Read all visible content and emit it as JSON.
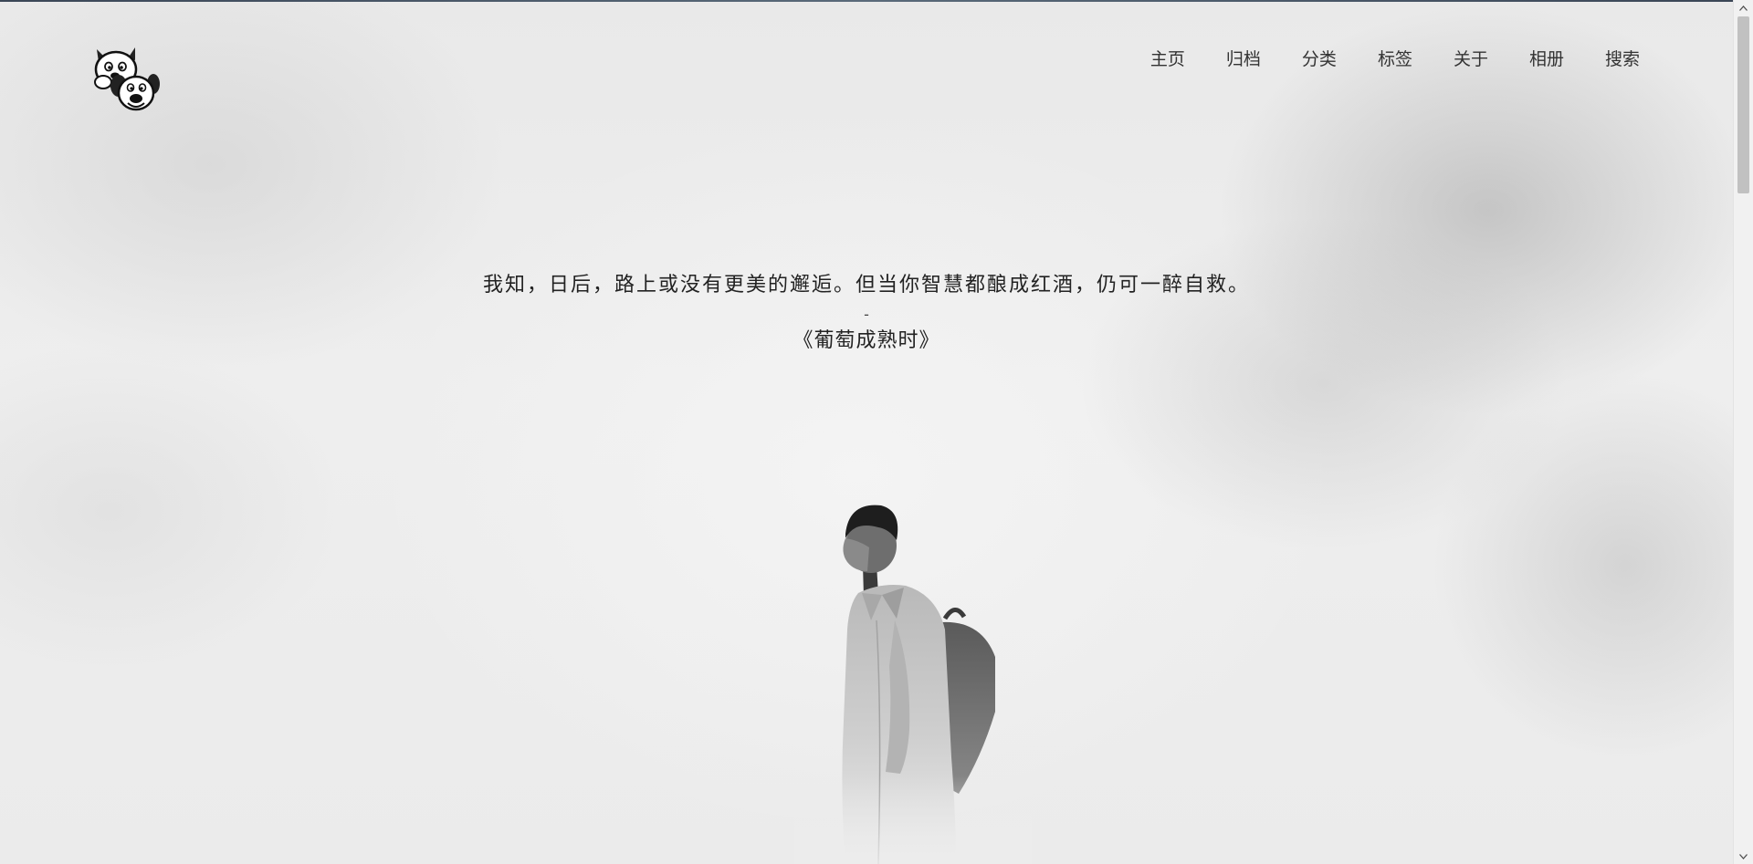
{
  "site": {
    "logo_icon": "cartoon-dogs-logo-icon"
  },
  "nav": {
    "items": [
      {
        "label": "主页"
      },
      {
        "label": "归档"
      },
      {
        "label": "分类"
      },
      {
        "label": "标签"
      },
      {
        "label": "关于"
      },
      {
        "label": "相册"
      },
      {
        "label": "搜索"
      }
    ]
  },
  "hero": {
    "quote": "我知，日后，路上或没有更美的邂逅。但当你智慧都酿成红酒，仍可一醉自救。",
    "separator": "-",
    "source": "《葡萄成熟时》",
    "image_subject": "man-with-backpack-in-fog"
  },
  "scrollbar": {
    "up_icon": "chevron-up-icon",
    "down_icon": "chevron-down-icon"
  },
  "colors": {
    "text": "#222222",
    "nav_text": "#333333",
    "background": "#ececec"
  }
}
